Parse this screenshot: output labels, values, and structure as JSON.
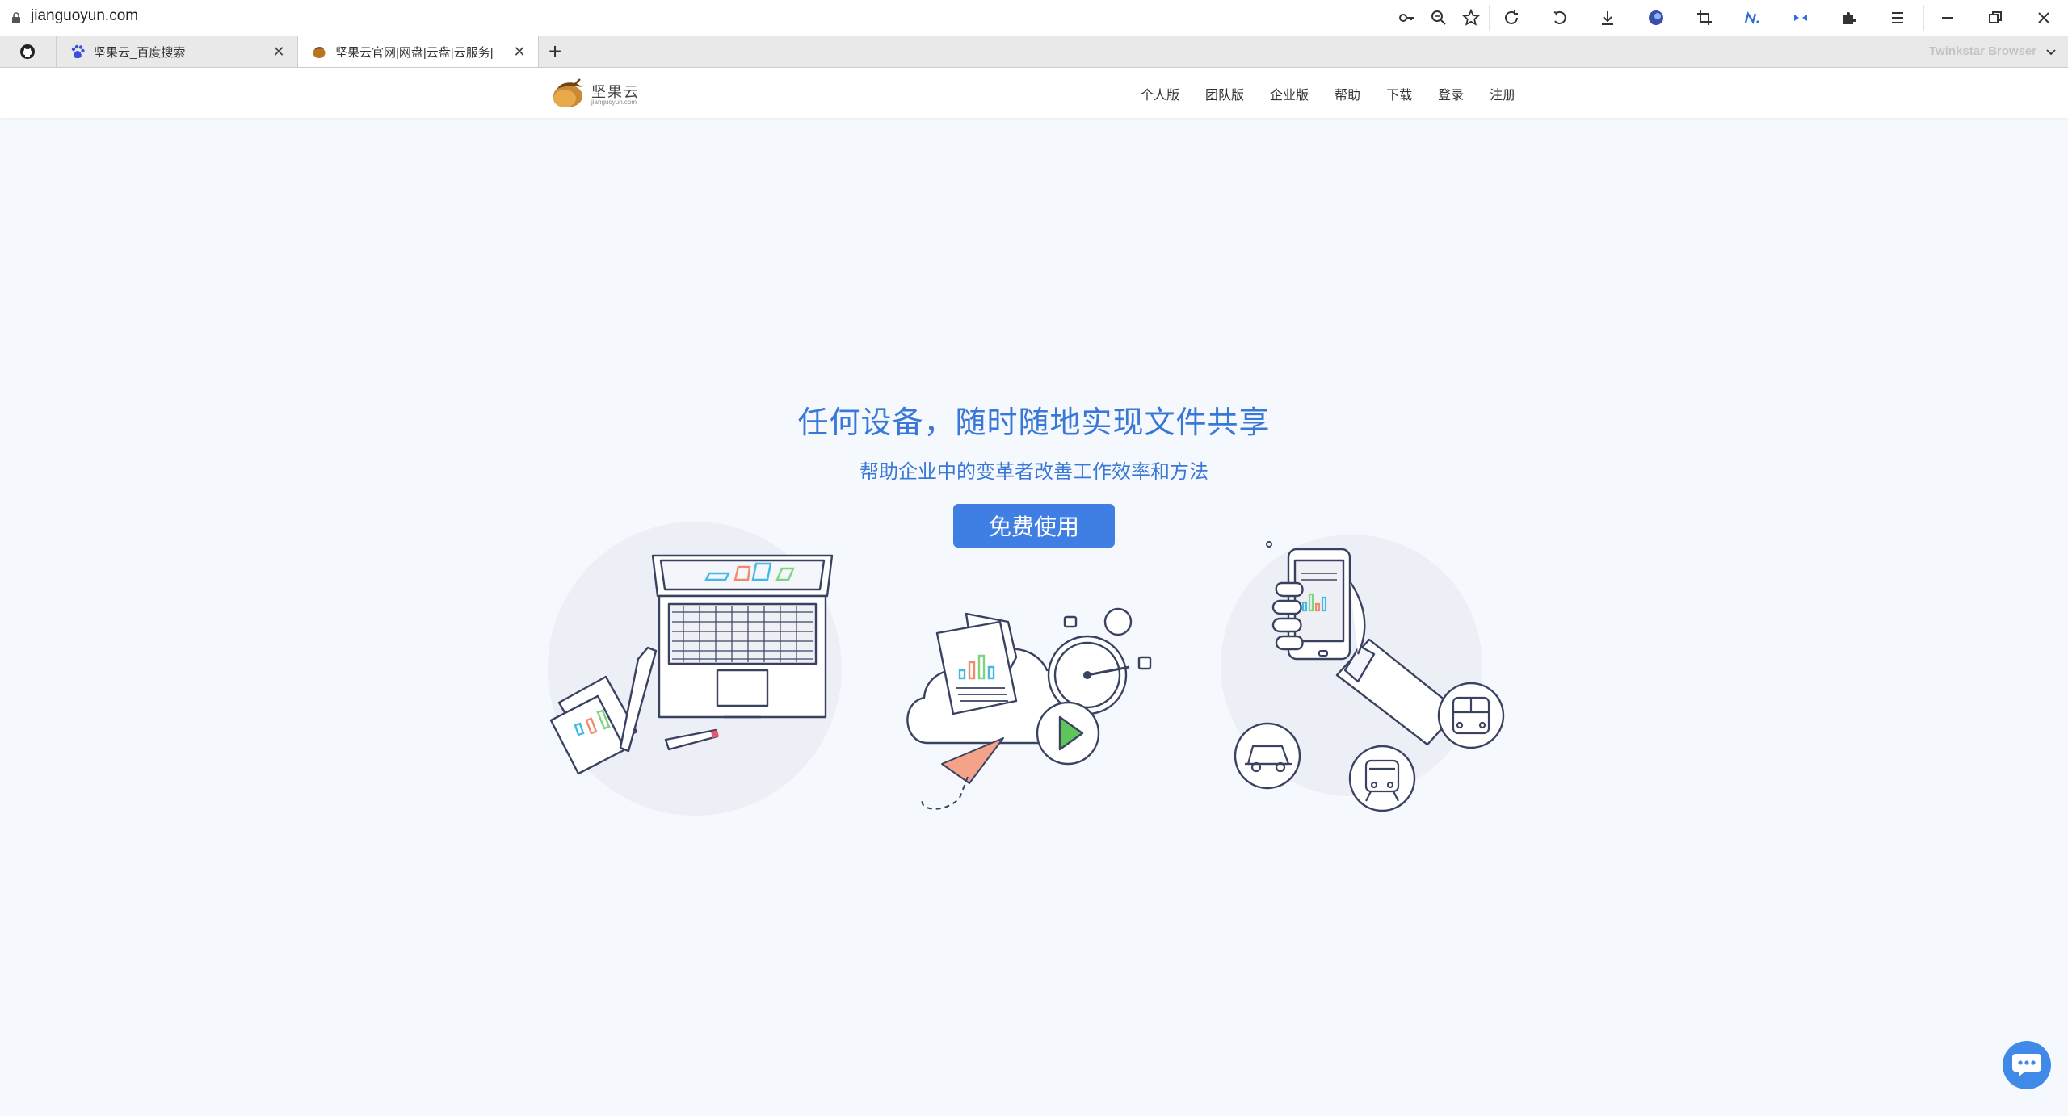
{
  "browser": {
    "url": "jianguoyun.com",
    "brand": "Twinkstar Browser",
    "toolbar_icons": [
      "key-icon",
      "zoom-icon",
      "star-icon",
      "refresh-icon",
      "undo-icon",
      "download-icon",
      "globe-extension-icon",
      "crop-icon",
      "n-extension-icon",
      "mirror-extension-icon",
      "puzzle-icon",
      "menu-icon",
      "minimize-icon",
      "restore-icon",
      "close-window-icon"
    ],
    "tabs": [
      {
        "title": "",
        "icon": "github-icon",
        "active": false
      },
      {
        "title": "坚果云_百度搜索",
        "icon": "baidu-icon",
        "active": false
      },
      {
        "title": "坚果云官网|网盘|云盘|云服务|",
        "icon": "jianguoyun-icon",
        "active": true
      }
    ],
    "new_tab": "+"
  },
  "site": {
    "logo_text": "坚果云",
    "logo_sub": "jianguoyun.com",
    "nav": [
      "个人版",
      "团队版",
      "企业版",
      "帮助",
      "下载",
      "登录",
      "注册"
    ]
  },
  "hero": {
    "title": "任何设备，随时随地实现文件共享",
    "subtitle": "帮助企业中的变革者改善工作效率和方法",
    "cta": "免费使用"
  },
  "colors": {
    "accent": "#3f7ee3",
    "title": "#3a78d8",
    "background": "#f5f8fc"
  }
}
